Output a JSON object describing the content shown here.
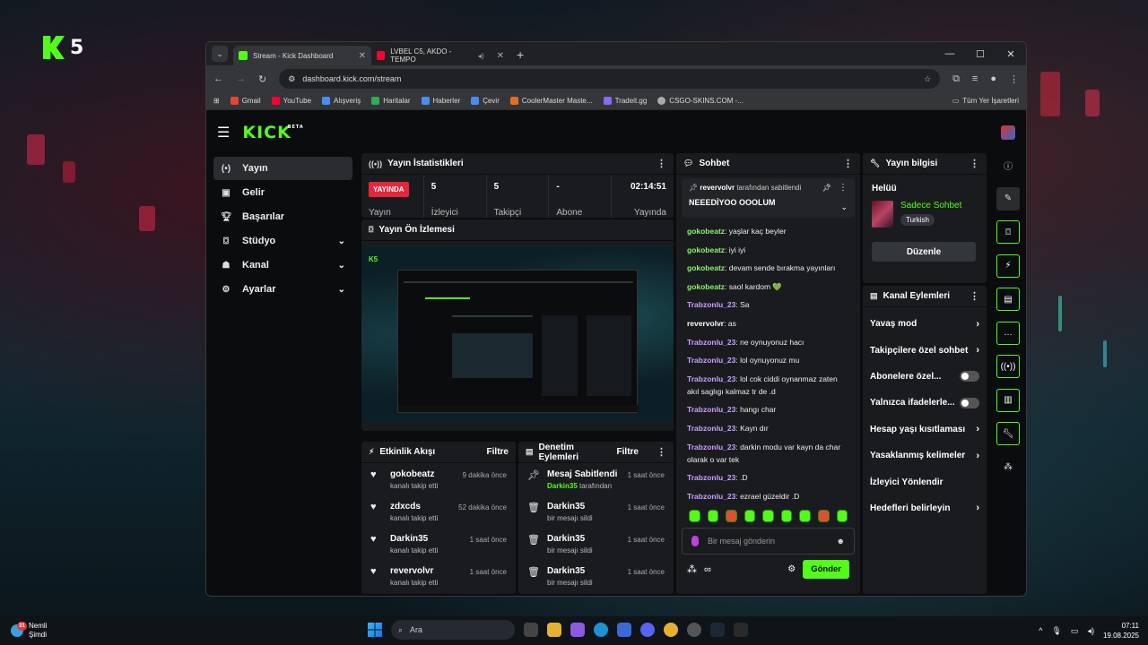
{
  "desktop": {
    "logo_number": "5"
  },
  "browser": {
    "tabs": [
      {
        "title": "Stream - Kick Dashboard",
        "active": true
      },
      {
        "title": "LVBEL C5, AKDO - TEMPO",
        "active": false
      }
    ],
    "url": "dashboard.kick.com/stream",
    "bookmarks": [
      "Gmail",
      "YouTube",
      "Alışveriş",
      "Haritalar",
      "Haberler",
      "Çevir",
      "CoolerMaster Maste...",
      "Tradeit.gg",
      "CSGO-SKINS.COM -..."
    ],
    "bookmarks_all": "Tüm Yer İşaretleri"
  },
  "app": {
    "logo": "KICK",
    "logo_badge": "BETA"
  },
  "nav": [
    {
      "label": "Yayın",
      "icon": "broadcast-icon"
    },
    {
      "label": "Gelir",
      "icon": "money-icon"
    },
    {
      "label": "Başarılar",
      "icon": "trophy-icon"
    },
    {
      "label": "Stüdyo",
      "icon": "studio-icon"
    },
    {
      "label": "Kanal",
      "icon": "person-icon"
    },
    {
      "label": "Ayarlar",
      "icon": "gear-icon"
    }
  ],
  "stats": {
    "title": "Yayın İstatistikleri",
    "live_badge": "YAYINDA",
    "live_label": "Yayın",
    "items": [
      {
        "value": "5",
        "label": "İzleyici"
      },
      {
        "value": "5",
        "label": "Takipçi"
      },
      {
        "value": "-",
        "label": "Abone"
      },
      {
        "value": "02:14:51",
        "label": "Yayında"
      }
    ]
  },
  "preview": {
    "title": "Yayın Ön İzlemesi"
  },
  "activity": {
    "title": "Etkinlik Akışı",
    "filter": "Filtre",
    "items": [
      {
        "name": "gokobeatz",
        "sub": "kanalı takip etti",
        "time": "9 dakika önce"
      },
      {
        "name": "zdxcds",
        "sub": "kanalı takip etti",
        "time": "52 dakika önce"
      },
      {
        "name": "Darkin35",
        "sub": "kanalı takip etti",
        "time": "1 saat önce"
      },
      {
        "name": "revervolvr",
        "sub": "kanalı takip etti",
        "time": "1 saat önce"
      }
    ]
  },
  "moderation": {
    "title": "Denetim Eylemleri",
    "filter": "Filtre",
    "items": [
      {
        "name": "Mesaj Sabitlendi",
        "sub_user": "Darkin35",
        "sub": "tarafından",
        "time": "1 saat önce"
      },
      {
        "name": "Darkin35",
        "sub": "bir mesajı sildi",
        "time": "1 saat önce"
      },
      {
        "name": "Darkin35",
        "sub": "bir mesajı sildi",
        "time": "1 saat önce"
      },
      {
        "name": "Darkin35",
        "sub": "bir mesajı sildi",
        "time": "1 saat önce"
      }
    ]
  },
  "chat": {
    "title": "Sohbet",
    "pinned": {
      "user": "revervolvr",
      "by": "tarafından sabitlendi",
      "message": "NEEEDİYOO OOOLUM"
    },
    "messages": [
      {
        "user": "gokobeatz",
        "text": "yaşlar kaç beyler",
        "color": "#8cf36b"
      },
      {
        "user": "gokobeatz",
        "text": "iyi iyi",
        "color": "#8cf36b"
      },
      {
        "user": "gokobeatz",
        "text": "devam sende bırakma yayınları",
        "color": "#8cf36b"
      },
      {
        "user": "gokobeatz",
        "text": "saol kardom 💚",
        "color": "#8cf36b"
      },
      {
        "user": "Trabzonlu_23",
        "text": "Sa",
        "color": "#c9a0ff"
      },
      {
        "user": "revervolvr",
        "text": "as",
        "color": "#ffffff"
      },
      {
        "user": "Trabzonlu_23",
        "text": "ne oynuyonuz hacı",
        "color": "#c9a0ff"
      },
      {
        "user": "Trabzonlu_23",
        "text": "lol oynuyonuz mu",
        "color": "#c9a0ff"
      },
      {
        "user": "Trabzonlu_23",
        "text": "lol cok ciddi oynanmaz zaten akıl saglıgı kalmaz tr de .d",
        "color": "#c9a0ff"
      },
      {
        "user": "Trabzonlu_23",
        "text": "hangı char",
        "color": "#c9a0ff"
      },
      {
        "user": "Trabzonlu_23",
        "text": "Kayn dır",
        "color": "#c9a0ff"
      },
      {
        "user": "Trabzonlu_23",
        "text": "darkin modu var kayn da char olarak o var tek",
        "color": "#c9a0ff"
      },
      {
        "user": "Trabzonlu_23",
        "text": ".D",
        "color": "#c9a0ff"
      },
      {
        "user": "Trabzonlu_23",
        "text": "ezrael güzeldir .D",
        "color": "#c9a0ff"
      }
    ],
    "input_placeholder": "Bir mesaj gönderin",
    "send": "Gönder"
  },
  "info": {
    "title": "Yayın bilgisi",
    "stream_title": "Helüü",
    "category": "Sadece Sohbet",
    "tag": "Turkish",
    "edit": "Düzenle"
  },
  "channel_actions": {
    "title": "Kanal Eylemleri",
    "items": [
      {
        "label": "Yavaş mod",
        "type": "chevron"
      },
      {
        "label": "Takipçilere özel sohbet",
        "type": "chevron"
      },
      {
        "label": "Abonelere özel...",
        "type": "toggle"
      },
      {
        "label": "Yalnızca ifadelerle...",
        "type": "toggle"
      },
      {
        "label": "Hesap yaşı kısıtlaması",
        "type": "chevron"
      },
      {
        "label": "Yasaklanmış kelimeler",
        "type": "chevron"
      },
      {
        "label": "İzleyici Yönlendir",
        "type": "none"
      },
      {
        "label": "Hedefleri belirleyin",
        "type": "chevron"
      }
    ]
  },
  "taskbar": {
    "weather_title": "Nemli",
    "weather_sub": "Şimdi",
    "weather_badge": "31",
    "search": "Ara",
    "time": "07:11",
    "date": "19.08.2025"
  }
}
